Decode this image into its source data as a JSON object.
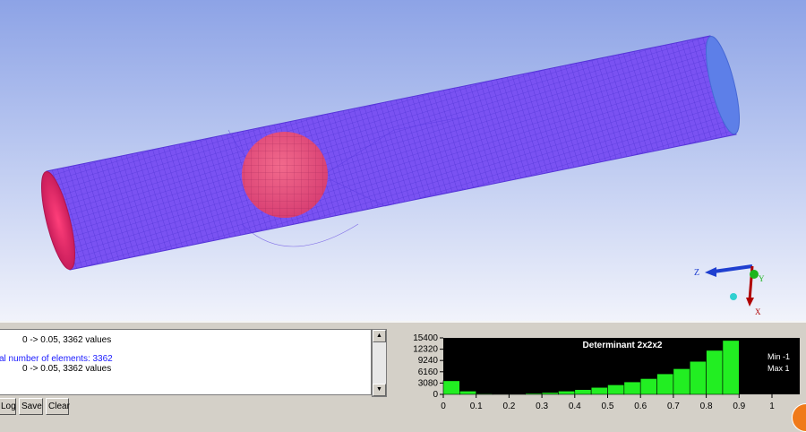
{
  "viewport": {
    "axis": {
      "z_label": "Z",
      "y_label": "Y",
      "x_label": "X"
    },
    "colors": {
      "mesh": "#7a4df0",
      "end_cap": "#e0306b",
      "sphere": "#e8557a",
      "background_top": "#8da3e6"
    }
  },
  "messages": {
    "lines": [
      {
        "text": "0 -> 0.05, 3362 values",
        "style": "indent"
      },
      {
        "text": "al number of elements: 3362",
        "style": "blue"
      },
      {
        "text": "0 -> 0.05, 3362 values",
        "style": "indent"
      }
    ]
  },
  "buttons": {
    "log": "Log",
    "save": "Save",
    "clear": "Clear"
  },
  "histogram": {
    "title": "Determinant 2x2x2",
    "min_label": "Min -1",
    "max_label": "Max 1"
  },
  "chart_data": {
    "type": "bar",
    "title": "Determinant 2x2x2",
    "x_ticks": [
      "0",
      "0.1",
      "0.2",
      "0.3",
      "0.4",
      "0.5",
      "0.6",
      "0.7",
      "0.8",
      "0.9",
      "1"
    ],
    "y_ticks": [
      "15400",
      "12320",
      "9240",
      "6160",
      "3080",
      "0"
    ],
    "ylim": [
      0,
      15400
    ],
    "xlim": [
      0,
      1
    ],
    "bin_width": 0.05,
    "values": [
      3700,
      900,
      200,
      150,
      150,
      300,
      500,
      900,
      1300,
      1900,
      2600,
      3400,
      4300,
      5600,
      7000,
      9000,
      12000,
      14700
    ],
    "colors": {
      "bar": "#22ee22",
      "background": "#000000",
      "text": "#ffffff"
    }
  }
}
